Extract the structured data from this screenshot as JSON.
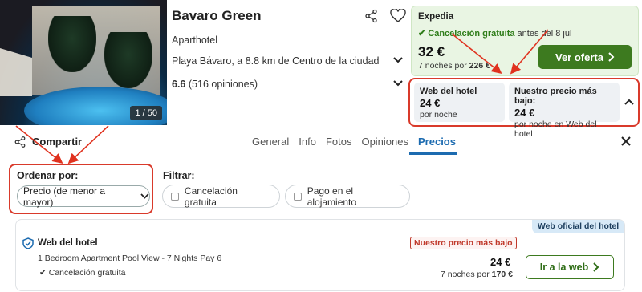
{
  "hotel": {
    "name": "Bavaro Green",
    "type": "Aparthotel",
    "location": "Playa Bávaro, a 8.8 km de Centro de la ciudad",
    "rating_score": "6.6",
    "rating_count": "(516 opiniones)",
    "photo_counter": "1 / 50"
  },
  "deal": {
    "site": "Expedia",
    "cancel_label": "Cancelación gratuita",
    "cancel_suffix": "antes del 8 jul",
    "price": "32 €",
    "nights_text": "7 noches por",
    "total": "226 €",
    "button": "Ver oferta",
    "accent": "#3d7a1f"
  },
  "compare": {
    "left_title": "Web del hotel",
    "left_price": "24 €",
    "left_sub": "por noche",
    "right_title": "Nuestro precio más bajo:",
    "right_price": "24 €",
    "right_sub": "por noche en Web del hotel",
    "highlight_color": "#d93a2b"
  },
  "tabs_bar": {
    "share": "Compartir",
    "tabs": [
      "General",
      "Info",
      "Fotos",
      "Opiniones",
      "Precios"
    ],
    "active_tab": "Precios"
  },
  "sort": {
    "label": "Ordenar por:",
    "selected": "Precio (de menor a mayor)"
  },
  "filters": {
    "label": "Filtrar:",
    "chips": [
      "Cancelación gratuita",
      "Pago en el alojamiento"
    ]
  },
  "offer": {
    "tag": "Web oficial del hotel",
    "site": "Web del hotel",
    "room": "1 Bedroom Apartment Pool View - 7 Nights Pay 6",
    "cancel": "Cancelación gratuita",
    "badge": "Nuestro precio más bajo",
    "price": "24 €",
    "nights_text": "7 noches por",
    "total": "170 €",
    "button": "Ir a la web"
  },
  "icons": [
    "share-icon",
    "heart-icon",
    "chevron-down-icon",
    "chevron-up-icon",
    "chevron-right-icon",
    "check-icon",
    "close-icon",
    "shield-icon",
    "checkbox-icon"
  ]
}
